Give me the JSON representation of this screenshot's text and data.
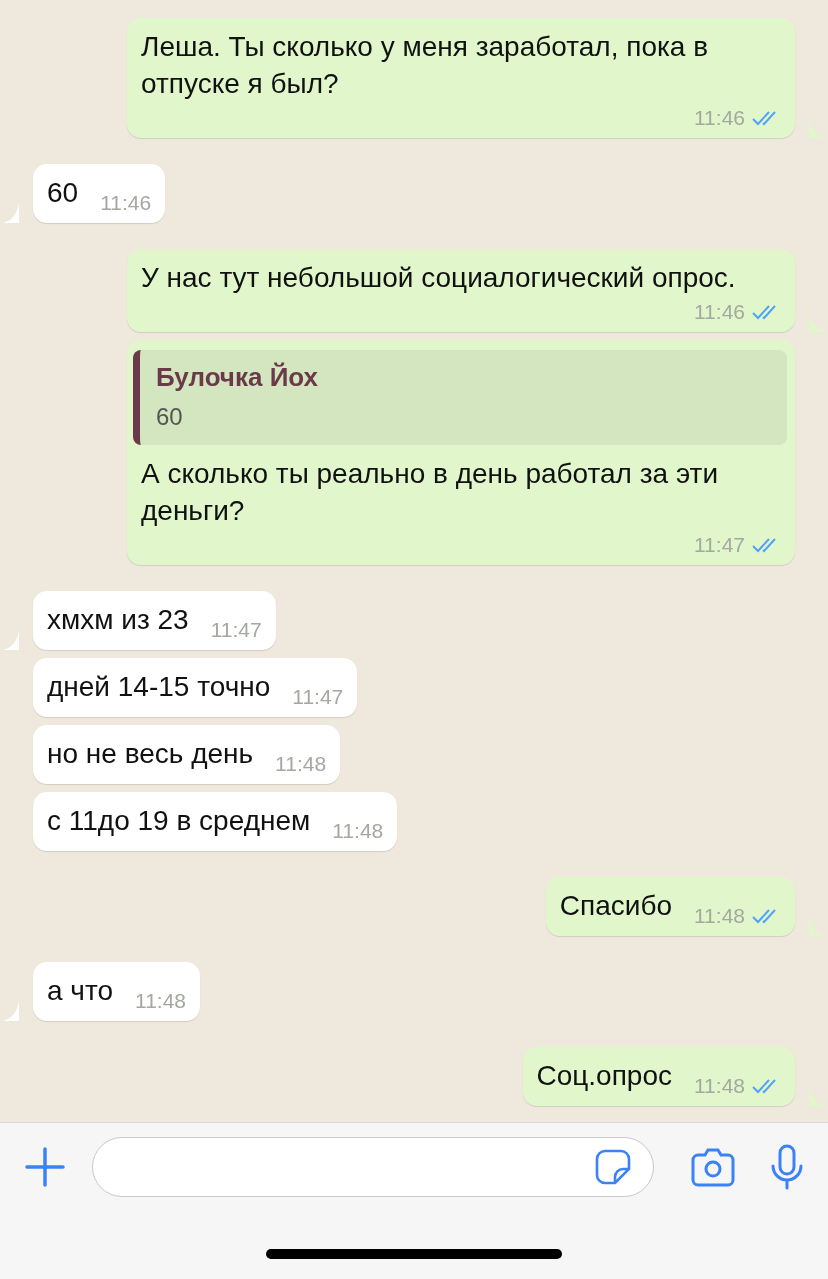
{
  "messages": [
    {
      "kind": "outgoing",
      "first_in_group": true,
      "text": "Леша. Ты сколько у меня заработал, пока в отпуске я был?",
      "time": "11:46",
      "read": true
    },
    {
      "kind": "incoming",
      "first_in_group": true,
      "text": "60",
      "time": "11:46"
    },
    {
      "kind": "outgoing",
      "first_in_group": true,
      "text": "У нас тут небольшой социалогический опрос.",
      "time": "11:46",
      "read": true
    },
    {
      "kind": "outgoing",
      "first_in_group": false,
      "quote": {
        "author": "Булочка Йох",
        "text": "60"
      },
      "text": "А сколько ты реально в день работал за эти деньги?",
      "time": "11:47",
      "read": true
    },
    {
      "kind": "incoming",
      "first_in_group": true,
      "text": "хмхм из 23",
      "time": "11:47"
    },
    {
      "kind": "incoming",
      "first_in_group": false,
      "text": "дней 14-15 точно",
      "time": "11:47"
    },
    {
      "kind": "incoming",
      "first_in_group": false,
      "text": "но не весь день",
      "time": "11:48"
    },
    {
      "kind": "incoming",
      "first_in_group": false,
      "text": "с 11до 19 в среднем",
      "time": "11:48"
    },
    {
      "kind": "outgoing",
      "first_in_group": true,
      "text": "Спасибо",
      "time": "11:48",
      "read": true
    },
    {
      "kind": "incoming",
      "first_in_group": true,
      "text": "а что",
      "time": "11:48"
    },
    {
      "kind": "outgoing",
      "first_in_group": true,
      "text": "Соц.опрос",
      "time": "11:48",
      "read": true
    }
  ]
}
